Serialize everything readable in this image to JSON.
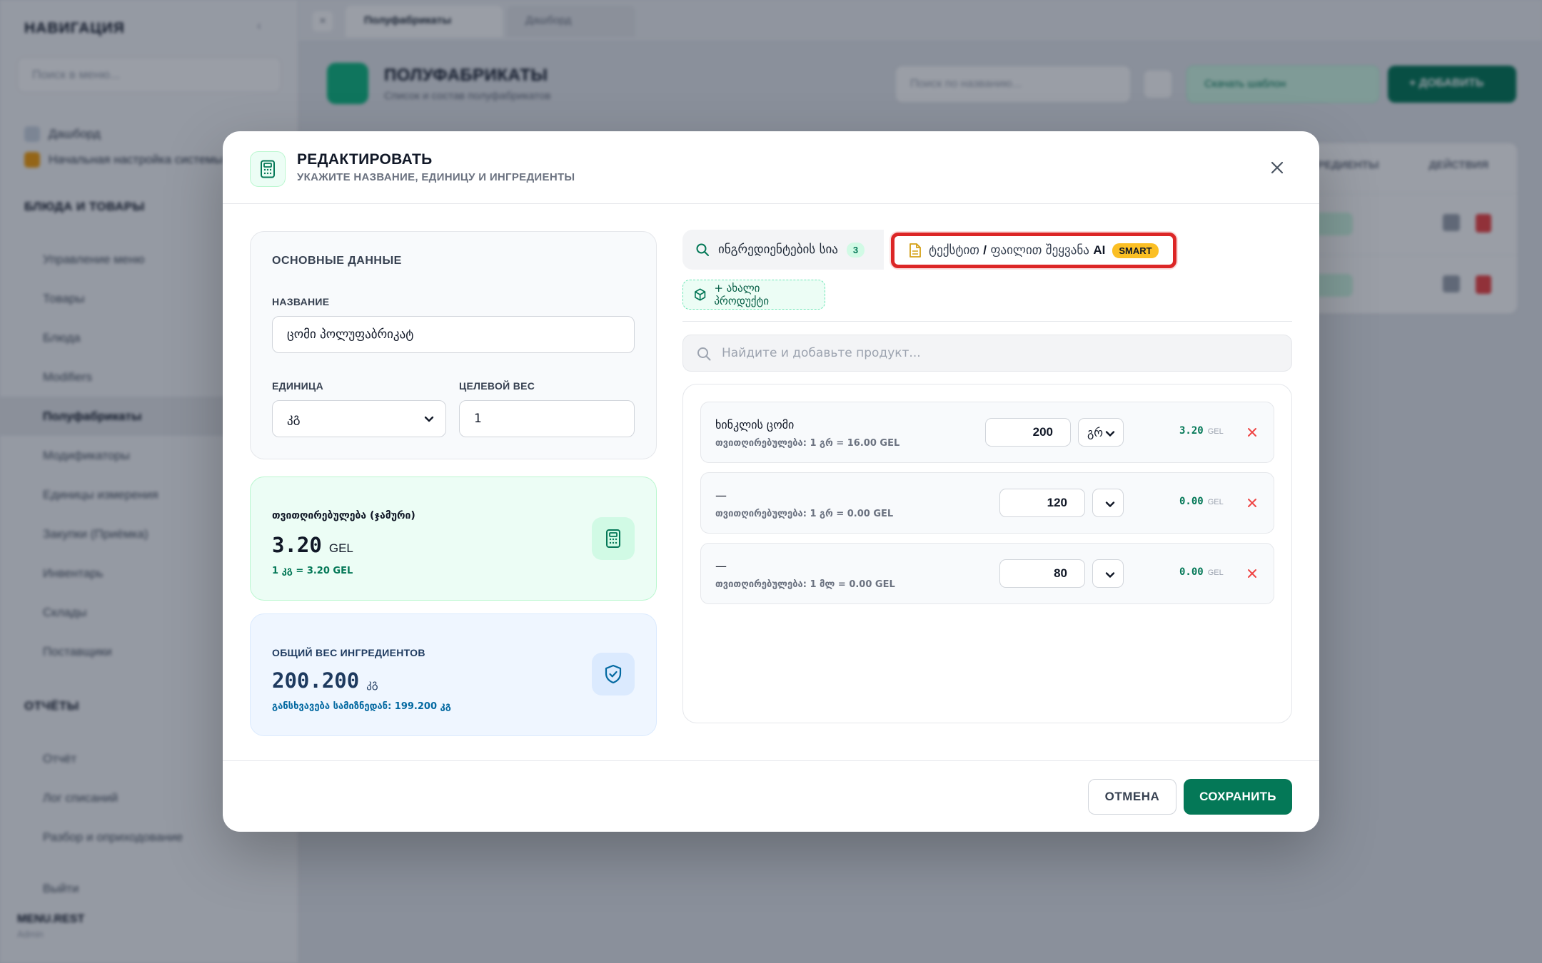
{
  "background": {
    "sidebar": {
      "title": "НАВИГАЦИЯ",
      "search_placeholder": "Поиск в меню...",
      "pinned": [
        "Дашборд",
        "Начальная настройка системы"
      ],
      "section1": "БЛЮДА И ТОВАРЫ",
      "items1": [
        "Управление меню",
        "Товары",
        "Блюда",
        "Modifiers",
        "Полуфабрикаты",
        "Модификаторы",
        "Единицы измерения",
        "Закупки (Приёмка)",
        "Инвентарь",
        "Склады",
        "Поставщики"
      ],
      "section2": "ОТЧЁТЫ",
      "items2": [
        "Отчёт",
        "Лог списаний",
        "Разбор и оприходование"
      ],
      "footer_item": "Выйти",
      "user_name": "MENU.REST",
      "user_sub": "Admin"
    },
    "tabs": [
      "Полуфабрикаты",
      "Дашборд"
    ],
    "page_title": "ПОЛУФАБРИКАТЫ",
    "page_sub": "Список и состав полуфабрикатов",
    "search_placeholder": "Поиск по названию...",
    "export_label": "Скачать шаблон",
    "add_label": "+ ДОБАВИТЬ",
    "table_headers": [
      "ИНГРЕДИЕНТЫ",
      "ДЕЙСТВИЯ"
    ]
  },
  "modal": {
    "title": "РЕДАКТИРОВАТЬ",
    "subtitle": "УКАЖИТЕ НАЗВАНИЕ, ЕДИНИЦУ И ИНГРЕДИЕНТЫ",
    "basic": {
      "heading": "ОСНОВНЫЕ ДАННЫЕ",
      "name_label": "НАЗВАНИЕ",
      "name_value": "ცომი პოლუფაბრიკატ",
      "unit_label": "ЕДИНИЦА",
      "unit_value": "კგ",
      "target_label": "ЦЕЛЕВОЙ ВЕС",
      "target_value": "1"
    },
    "cost_card": {
      "label": "თვითღირებულება (ჯამური)",
      "value": "3.20",
      "currency": "GEL",
      "note": "1 კგ = 3.20 GEL"
    },
    "weight_card": {
      "label": "ОБЩИЙ ВЕС ИНГРЕДИЕНТОВ",
      "value": "200.200",
      "unit": "კგ",
      "note": "განსხვავება სამიზნედან: 199.200 კგ"
    },
    "tabs": {
      "ingredients_label": "ინგრედიენტების სია",
      "ingredients_count": "3",
      "ai_label_a": "ტექსტით",
      "ai_label_sep": "/",
      "ai_label_b": "ფაილით შეყვანა",
      "ai_word": "AI",
      "ai_badge": "SMART"
    },
    "new_product_label": "+ ახალი პროდუქტი",
    "product_search_placeholder": "Найдите и добавьте продукт...",
    "ingredients": [
      {
        "name": "ხინკლის ცომი",
        "cost": "თვითღირებულება: 1 გრ = 16.00 GEL",
        "qty": "200",
        "unit": "გრ",
        "total": "3.20",
        "currency": "GEL"
      },
      {
        "name": "—",
        "cost": "თვითღირებულება: 1 გრ = 0.00 GEL",
        "qty": "120",
        "unit": "",
        "total": "0.00",
        "currency": "GEL"
      },
      {
        "name": "—",
        "cost": "თვითღირებულება: 1 მლ = 0.00 GEL",
        "qty": "80",
        "unit": "",
        "total": "0.00",
        "currency": "GEL"
      }
    ],
    "cancel_label": "ОТМЕНА",
    "save_label": "СОХРАНИТЬ"
  },
  "colors": {
    "accent": "#047857",
    "highlight": "#dc2626",
    "badge_smart": "#fbbf24"
  },
  "icons": [
    "calculator-icon",
    "close-icon",
    "search-icon",
    "document-icon",
    "package-plus-icon",
    "shield-check-icon",
    "chevron-down-icon",
    "x-icon"
  ]
}
